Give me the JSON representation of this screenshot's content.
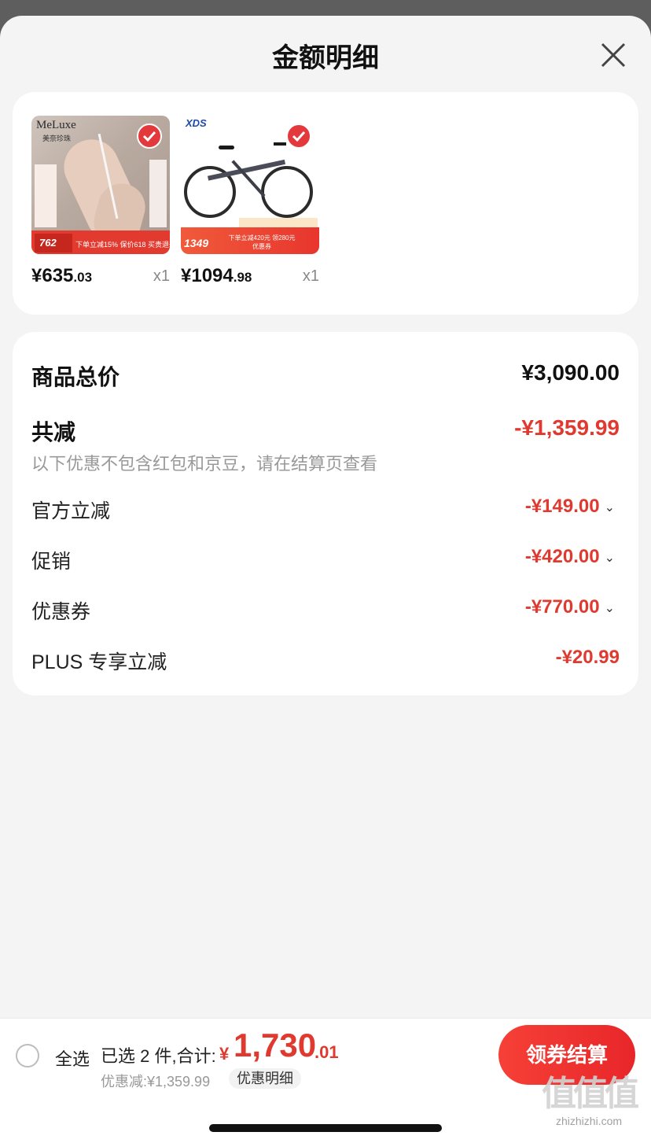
{
  "sheet": {
    "title": "金额明细"
  },
  "products": [
    {
      "name": "MeLuxe 美奈珍珠",
      "brand": "MeLuxe",
      "brand_sub": "美奈珍珠",
      "banner_price": "762",
      "banner_text": "下单立减15% 保价618 买贵退差",
      "price_int": "¥635",
      "price_dec": ".03",
      "qty": "x1",
      "selected": true
    },
    {
      "name": "XDS 山地自行车",
      "brand": "XDS",
      "banner_price": "1349",
      "banner_text": "下单立减420元 领280元优惠券",
      "price_int": "¥1094",
      "price_dec": ".98",
      "qty": "x1",
      "selected": true
    }
  ],
  "summary": {
    "total_label": "商品总价",
    "total_value": "¥3,090.00",
    "reduce_label": "共减",
    "reduce_value": "-¥1,359.99",
    "note": "以下优惠不包含红包和京豆，请在结算页查看",
    "items": [
      {
        "label": "官方立减",
        "value": "-¥149.00",
        "expandable": true
      },
      {
        "label": "促销",
        "value": "-¥420.00",
        "expandable": true
      },
      {
        "label": "优惠券",
        "value": "-¥770.00",
        "expandable": true
      },
      {
        "label": "PLUS 专享立减",
        "value": "-¥20.99",
        "expandable": false
      }
    ]
  },
  "bottom_bar": {
    "select_all_label": "全选",
    "selected_text": "已选 2 件,合计:",
    "sum_yen": "¥",
    "sum_int": "1,730",
    "sum_dec": ".01",
    "discount_text": "优惠减:¥1,359.99",
    "detail_link": "优惠明细",
    "checkout_button": "领券结算"
  },
  "watermark": {
    "glyphs": "值值值",
    "url": "zhizhizhi.com"
  },
  "colors": {
    "accent_red": "#e0392f",
    "button_red": "#f64037",
    "sheet_bg": "#f4f4f4"
  }
}
